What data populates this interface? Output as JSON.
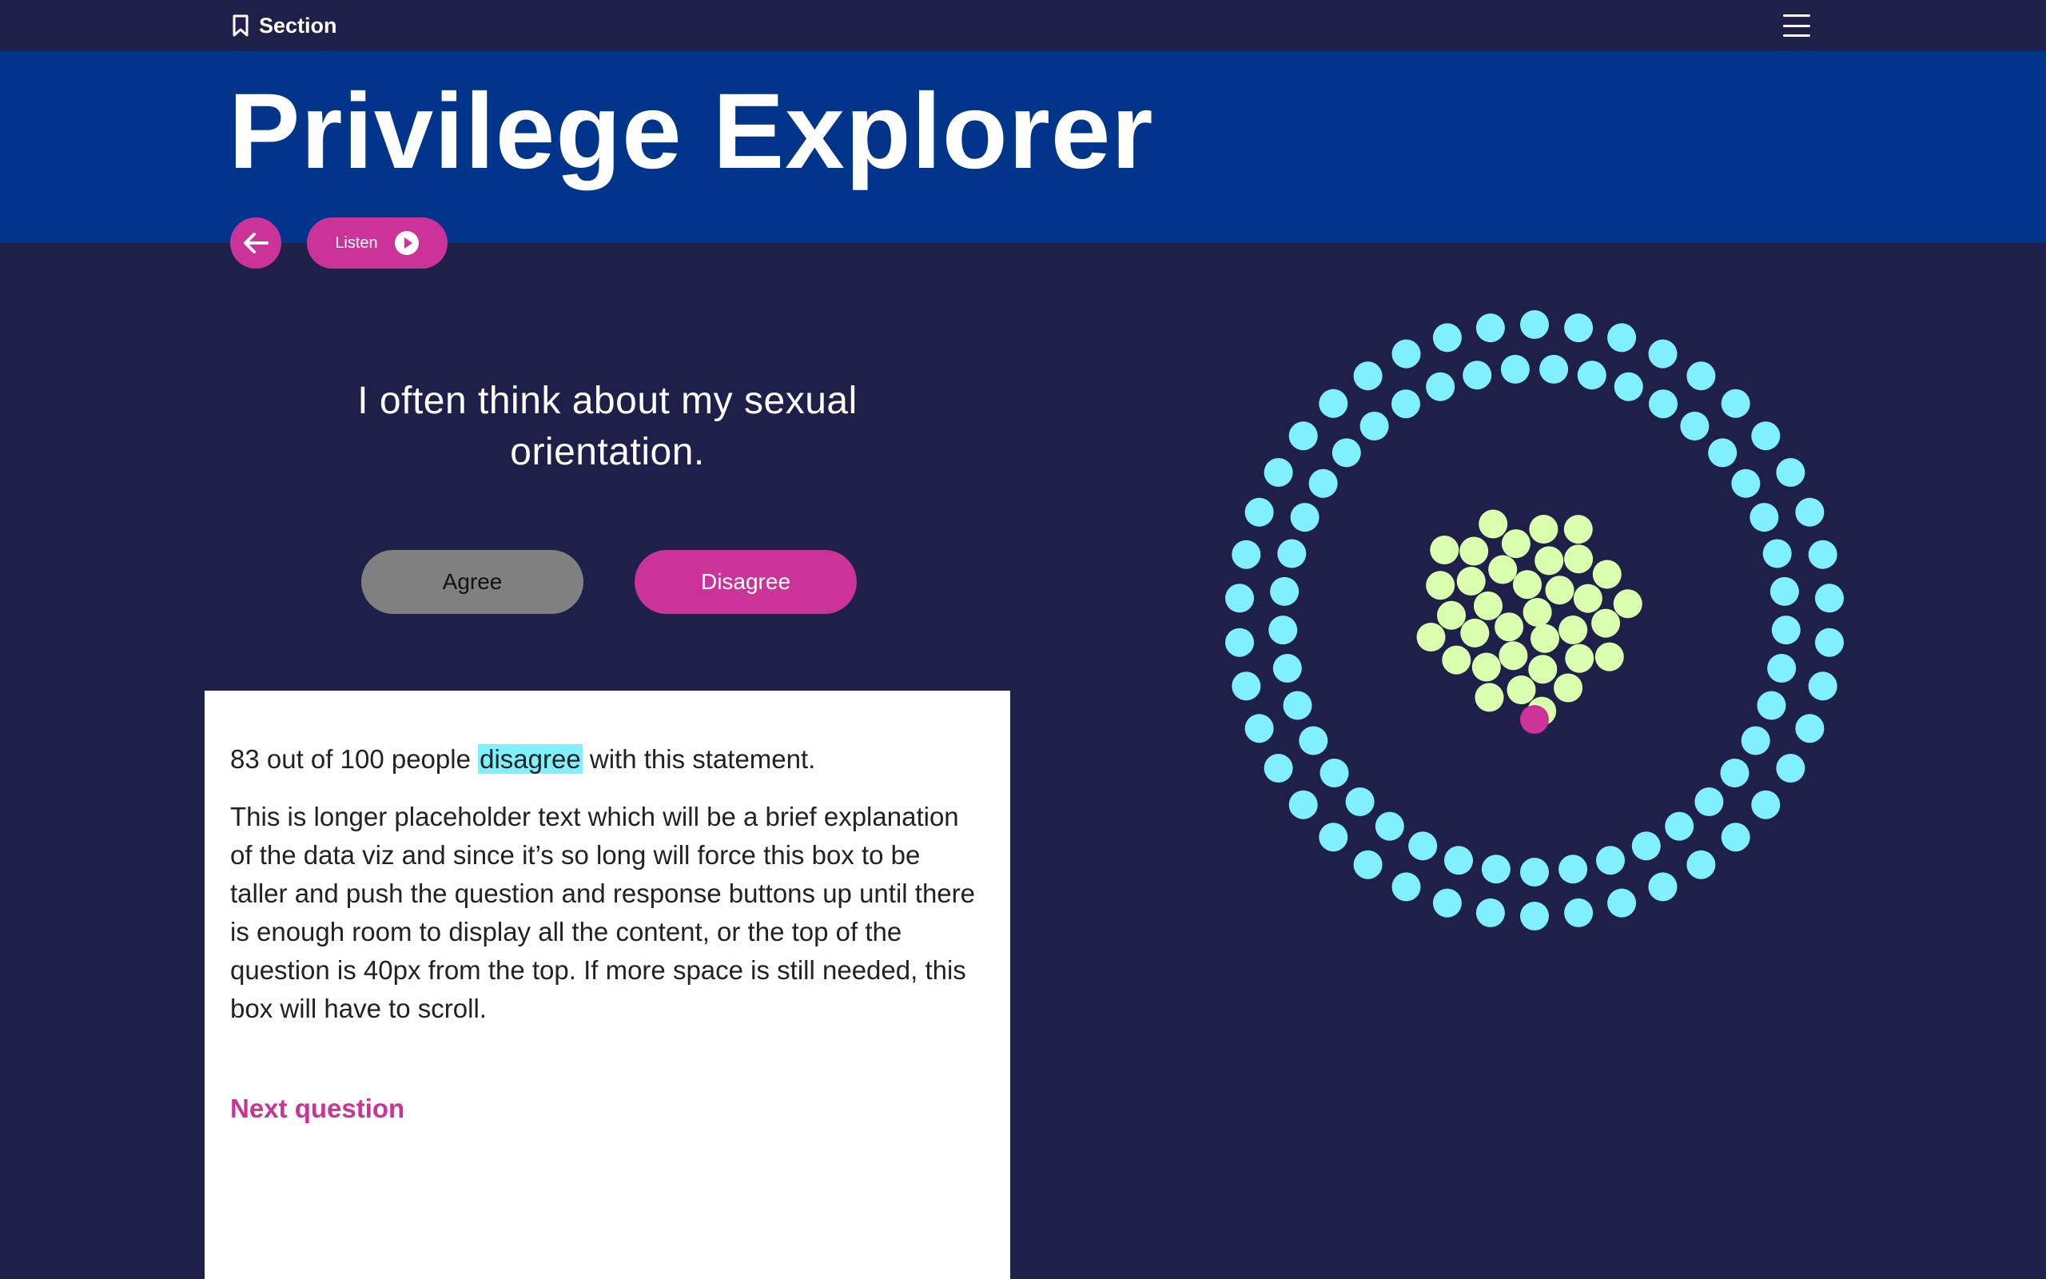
{
  "topbar": {
    "section_label": "Section"
  },
  "banner": {
    "title": "Privilege Explorer"
  },
  "controls": {
    "listen_label": "Listen"
  },
  "question": {
    "text": "I often think about my sexual orientation.",
    "agree_label": "Agree",
    "disagree_label": "Disagree"
  },
  "result": {
    "stat_prefix": "83 out of 100 people",
    "stat_highlight": "disagree",
    "stat_suffix": "with this statement.",
    "explanation": "This is longer placeholder text which will be a brief explanation of the data viz and since it’s so long will force this box to be taller and push the question and response buttons up until there is enough room to display all the content, or the top of the question is 40px from the top. If more space is still needed, this box will have to scroll.",
    "next_label": "Next question"
  },
  "colors": {
    "background": "#1f204a",
    "banner": "#01348b",
    "accent": "#cc3399",
    "highlight": "#80f0ff",
    "outer_dots": "#80f0ff",
    "inner_dots": "#d9ffae",
    "selected_dot": "#cc3399"
  },
  "visualization": {
    "outer_dot_count": 83,
    "inner_dot_count": 35,
    "selected_dot_count": 1
  }
}
